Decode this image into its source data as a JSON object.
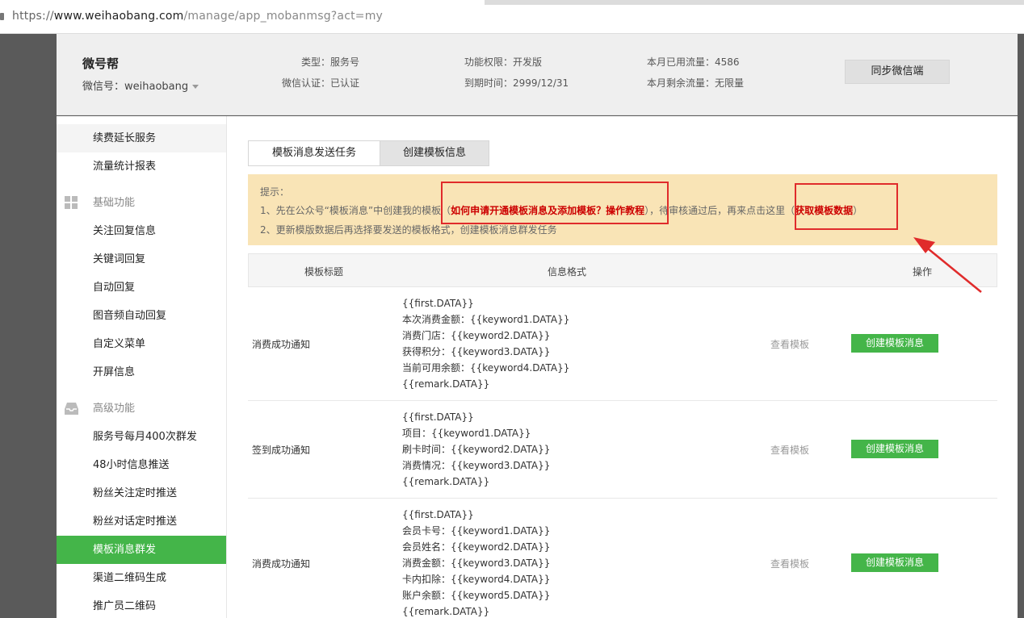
{
  "browser": {
    "url_prefix": "https://",
    "url_host": "www.weihaobang.com",
    "url_path": "/manage/app_mobanmsg?act=my"
  },
  "account": {
    "name": "微号帮",
    "wxid": "微信号：weihaobang",
    "type": "类型：服务号",
    "verify": "微信认证：已认证",
    "permission": "功能权限：开发版",
    "expire": "到期时间：2999/12/31",
    "used_flow": "本月已用流量：4586",
    "remain_flow": "本月剩余流量：无限量",
    "sync_button": "同步微信端"
  },
  "sidebar": {
    "items_top": [
      "续费延长服务",
      "流量统计报表"
    ],
    "section_basic": "基础功能",
    "items_basic": [
      "关注回复信息",
      "关键词回复",
      "自动回复",
      "图音频自动回复",
      "自定义菜单",
      "开屏信息"
    ],
    "section_advanced": "高级功能",
    "items_advanced": [
      "服务号每月400次群发",
      "48小时信息推送",
      "粉丝关注定时推送",
      "粉丝对话定时推送",
      "模板消息群发",
      "渠道二维码生成",
      "推广员二维码"
    ],
    "active": "模板消息群发"
  },
  "tabs": {
    "send_tasks": "模板消息发送任务",
    "create_template": "创建模板信息"
  },
  "notice": {
    "label": "提示：",
    "line1_a": "1、先在公众号“模板消息”中创建我的模板（",
    "line1_link1": "如何申请开通模板消息及添加模板？操作教程",
    "line1_b": "），待审核通过后，再来点击这里（",
    "line1_link2": "获取模板数据",
    "line1_c": "）",
    "line2": "2、更新模版数据后再选择要发送的模板格式，创建模板消息群发任务"
  },
  "table": {
    "col_title": "模板标题",
    "col_format": "信息格式",
    "col_action": "操作",
    "view_label": "查看模板",
    "create_label": "创建模板消息",
    "rows": [
      {
        "title": "消费成功通知",
        "fmt": [
          "{{first.DATA}}",
          "本次消费金额：{{keyword1.DATA}}",
          "消费门店：{{keyword2.DATA}}",
          "获得积分：{{keyword3.DATA}}",
          "当前可用余额：{{keyword4.DATA}}",
          "{{remark.DATA}}"
        ]
      },
      {
        "title": "签到成功通知",
        "fmt": [
          "{{first.DATA}}",
          "项目：{{keyword1.DATA}}",
          "刷卡时间：{{keyword2.DATA}}",
          "消费情况：{{keyword3.DATA}}",
          "{{remark.DATA}}"
        ]
      },
      {
        "title": "消费成功通知",
        "fmt": [
          "{{first.DATA}}",
          "会员卡号：{{keyword1.DATA}}",
          "会员姓名：{{keyword2.DATA}}",
          "消费金额：{{keyword3.DATA}}",
          "卡内扣除：{{keyword4.DATA}}",
          "账户余额：{{keyword5.DATA}}",
          "{{remark.DATA}}"
        ]
      }
    ]
  },
  "colors": {
    "accent_green": "#44b549",
    "notice_bg": "#f9e4b6",
    "annotation_red": "#e02b2b"
  }
}
